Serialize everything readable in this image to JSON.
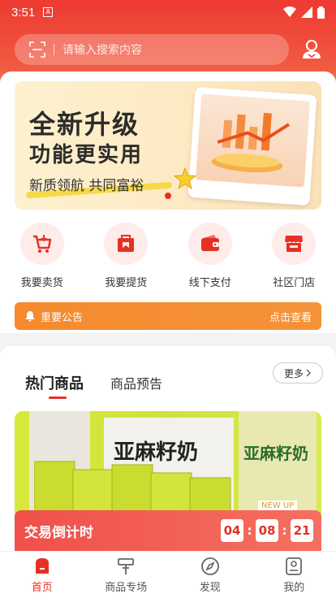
{
  "status_bar": {
    "time": "3:51",
    "app_badge": "A"
  },
  "search": {
    "placeholder": "请输入搜索内容"
  },
  "banner": {
    "line1": "全新升级",
    "line2": "功能更实用",
    "line3": "新质领航 共同富裕"
  },
  "shortcuts": [
    {
      "label": "我要卖货",
      "icon": "cart-icon"
    },
    {
      "label": "我要提货",
      "icon": "bag-icon"
    },
    {
      "label": "线下支付",
      "icon": "wallet-icon"
    },
    {
      "label": "社区门店",
      "icon": "store-icon"
    }
  ],
  "notice": {
    "label": "重要公告",
    "action": "点击查看"
  },
  "products": {
    "tab_hot": "热门商品",
    "tab_preview": "商品预告",
    "more": "更多",
    "product_title": "亚麻籽奶",
    "product_title_right": "亚麻籽奶",
    "badge": "NEW UP"
  },
  "countdown": {
    "title": "交易倒计时",
    "hours": "04",
    "minutes": "08",
    "seconds": "21"
  },
  "tabbar": [
    {
      "label": "首页",
      "active": true
    },
    {
      "label": "商品专场",
      "active": false
    },
    {
      "label": "发现",
      "active": false
    },
    {
      "label": "我的",
      "active": false
    }
  ],
  "colors": {
    "primary": "#e63024",
    "notice": "#f58a2e",
    "header": "#ee3a32"
  }
}
